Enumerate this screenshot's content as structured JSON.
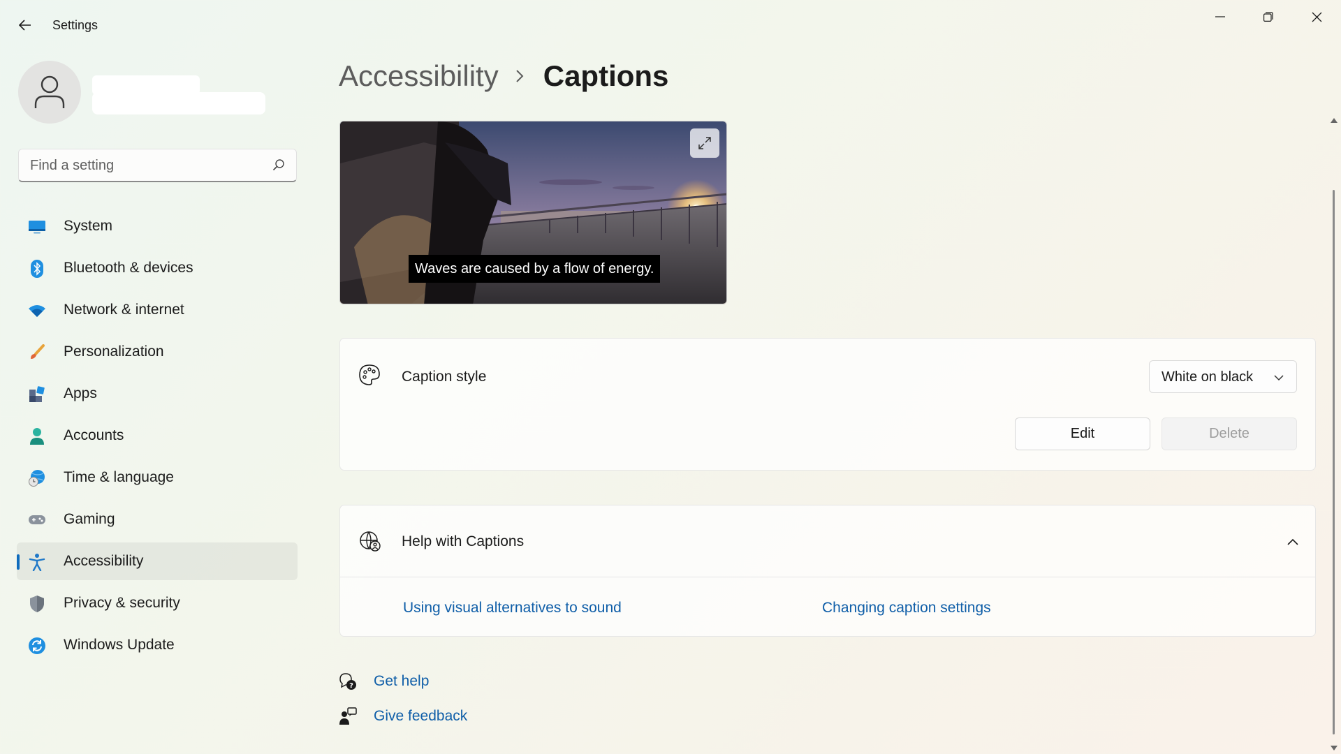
{
  "window": {
    "title": "Settings",
    "controls": [
      "minimize",
      "restore",
      "close"
    ]
  },
  "search": {
    "placeholder": "Find a setting",
    "value": ""
  },
  "sidebar": {
    "items": [
      {
        "label": "System",
        "icon": "monitor-icon",
        "active": false
      },
      {
        "label": "Bluetooth & devices",
        "icon": "bluetooth-icon",
        "active": false
      },
      {
        "label": "Network & internet",
        "icon": "wifi-icon",
        "active": false
      },
      {
        "label": "Personalization",
        "icon": "brush-icon",
        "active": false
      },
      {
        "label": "Apps",
        "icon": "apps-icon",
        "active": false
      },
      {
        "label": "Accounts",
        "icon": "person-icon",
        "active": false
      },
      {
        "label": "Time & language",
        "icon": "globe-clock-icon",
        "active": false
      },
      {
        "label": "Gaming",
        "icon": "gamepad-icon",
        "active": false
      },
      {
        "label": "Accessibility",
        "icon": "accessibility-icon",
        "active": true
      },
      {
        "label": "Privacy & security",
        "icon": "shield-icon",
        "active": false
      },
      {
        "label": "Windows Update",
        "icon": "update-icon",
        "active": false
      }
    ]
  },
  "breadcrumb": {
    "parent": "Accessibility",
    "current": "Captions"
  },
  "preview": {
    "caption_text": "Waves are caused by a flow of energy."
  },
  "caption_style": {
    "label": "Caption style",
    "selected": "White on black",
    "edit_label": "Edit",
    "delete_label": "Delete",
    "delete_enabled": false
  },
  "help": {
    "title": "Help with Captions",
    "expanded": true,
    "links": [
      "Using visual alternatives to sound",
      "Changing caption settings"
    ]
  },
  "footer": {
    "get_help": "Get help",
    "give_feedback": "Give feedback"
  },
  "colors": {
    "accent": "#0f6cbd",
    "link": "#0f5ea8"
  }
}
